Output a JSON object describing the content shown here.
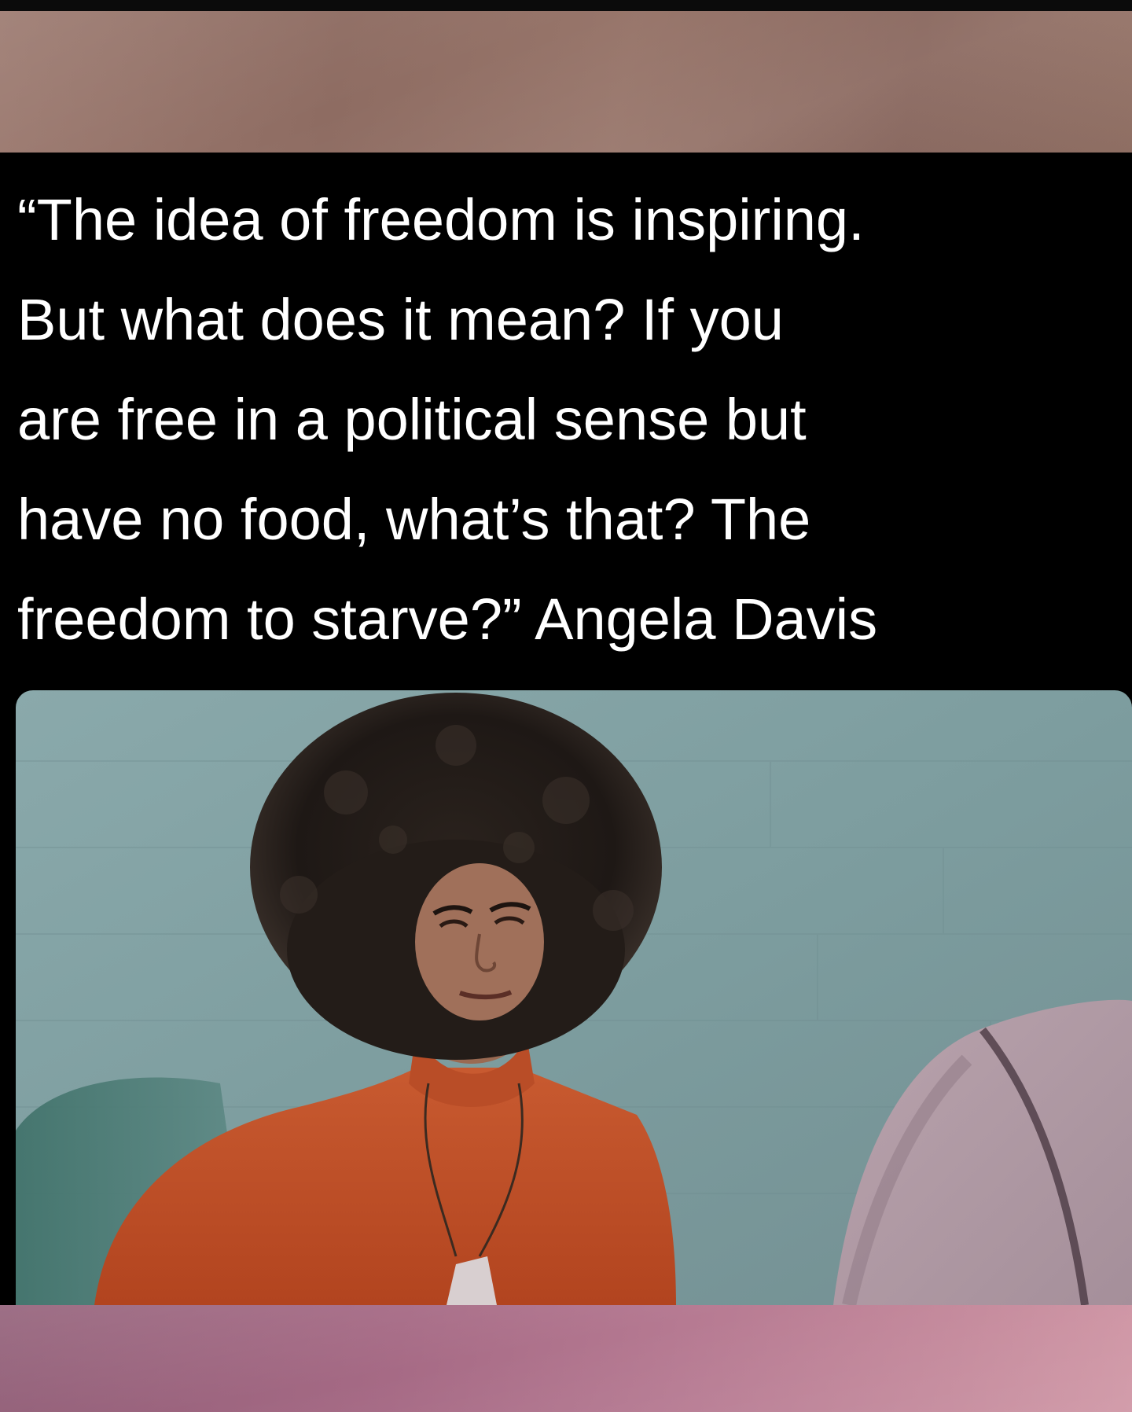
{
  "quote": {
    "lines": [
      "“The idea of freedom is inspiring.",
      "But what does it mean? If you",
      "are free in a political sense but",
      "have no food, what’s that? The",
      "freedom to starve?” Angela Davis"
    ]
  },
  "colors": {
    "top_band": "#967468",
    "quote_background": "#000000",
    "quote_text": "#ffffff",
    "photo_wall": "#7f9fa2",
    "sweater": "#c4532b",
    "bottom_band": "#b67a92"
  },
  "photo": {
    "subject": "person-with-afro-in-orange-turtleneck"
  }
}
